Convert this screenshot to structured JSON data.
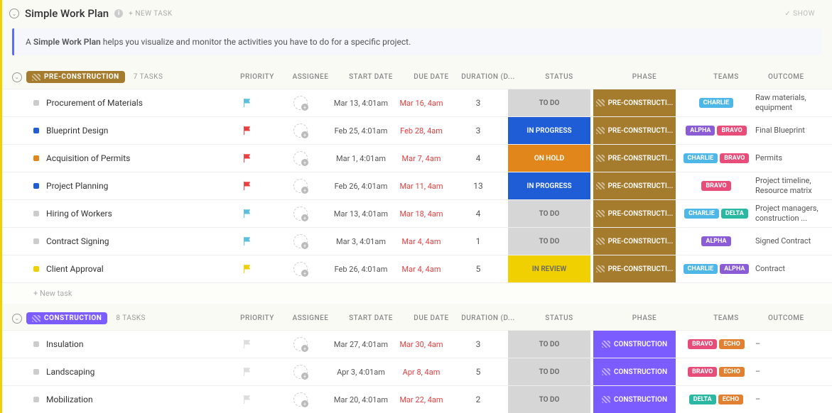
{
  "header": {
    "title": "Simple Work Plan",
    "new_task": "+ NEW TASK",
    "show": "✓ SHOW"
  },
  "description": {
    "prefix": "A ",
    "emph": "Simple Work Plan",
    "suffix": " helps you visualize and monitor the activities you have to do for a specific project."
  },
  "columns": {
    "priority": "PRIORITY",
    "assignee": "ASSIGNEE",
    "start": "START DATE",
    "due": "DUE DATE",
    "duration": "DURATION (D...",
    "status": "STATUS",
    "phase": "PHASE",
    "teams": "TEAMS",
    "outcome": "OUTCOME"
  },
  "new_task_row": "+ New task",
  "groups": [
    {
      "name": "PRE-CONSTRUCTION",
      "color": "brown",
      "count": "7 TASKS",
      "phase_label": "PRE-CONSTRUCTI...",
      "phase_color": "ph-brown",
      "rows": [
        {
          "name": "Procurement of Materials",
          "dot": "sd-gray",
          "flag": "#5bc0de",
          "start": "Mar 13, 4:01am",
          "due": "Mar 16, 4am",
          "dur": "3",
          "status": "TO DO",
          "st": "st-todo",
          "teams": [
            {
              "n": "CHARLIE",
              "c": "tp-charlie"
            }
          ],
          "outcome": "Raw materials, equipment"
        },
        {
          "name": "Blueprint Design",
          "dot": "sd-blue",
          "flag": "#e84040",
          "start": "Feb 25, 4:01am",
          "due": "Feb 28, 4am",
          "dur": "3",
          "status": "IN PROGRESS",
          "st": "st-progress",
          "teams": [
            {
              "n": "ALPHA",
              "c": "tp-alpha"
            },
            {
              "n": "BRAVO",
              "c": "tp-bravo"
            }
          ],
          "outcome": "Final Blueprint"
        },
        {
          "name": "Acquisition of Permits",
          "dot": "sd-orange",
          "flag": "#e84040",
          "start": "Mar 1, 4:01am",
          "due": "Mar 7, 4am",
          "dur": "4",
          "status": "ON HOLD",
          "st": "st-hold",
          "teams": [
            {
              "n": "CHARLIE",
              "c": "tp-charlie"
            },
            {
              "n": "BRAVO",
              "c": "tp-bravo"
            }
          ],
          "outcome": "Permits"
        },
        {
          "name": "Project Planning",
          "dot": "sd-blue",
          "flag": "#e84040",
          "start": "Feb 26, 4:01am",
          "due": "Mar 11, 4am",
          "dur": "13",
          "status": "IN PROGRESS",
          "st": "st-progress",
          "teams": [
            {
              "n": "BRAVO",
              "c": "tp-bravo"
            }
          ],
          "outcome": "Project timeline, Resource matrix"
        },
        {
          "name": "Hiring of Workers",
          "dot": "sd-gray",
          "flag": "#5bc0de",
          "start": "Mar 13, 4:01am",
          "due": "Mar 18, 4am",
          "dur": "4",
          "status": "TO DO",
          "st": "st-todo",
          "teams": [
            {
              "n": "CHARLIE",
              "c": "tp-charlie"
            },
            {
              "n": "DELTA",
              "c": "tp-delta"
            }
          ],
          "outcome": "Project managers, construction ..."
        },
        {
          "name": "Contract Signing",
          "dot": "sd-gray",
          "flag": "#5bc0de",
          "start": "Mar 3, 4:01am",
          "due": "Mar 4, 4am",
          "dur": "1",
          "status": "TO DO",
          "st": "st-todo",
          "teams": [
            {
              "n": "ALPHA",
              "c": "tp-alpha"
            }
          ],
          "outcome": "Signed Contract"
        },
        {
          "name": "Client Approval",
          "dot": "sd-yellow",
          "flag": "#f0d000",
          "start": "Feb 26, 4:01am",
          "due": "Mar 4, 4am",
          "dur": "5",
          "status": "IN REVIEW",
          "st": "st-review",
          "teams": [
            {
              "n": "CHARLIE",
              "c": "tp-charlie"
            },
            {
              "n": "ALPHA",
              "c": "tp-alpha"
            }
          ],
          "outcome": "Contract"
        }
      ],
      "show_new": true
    },
    {
      "name": "CONSTRUCTION",
      "color": "purple",
      "count": "8 TASKS",
      "phase_label": "CONSTRUCTION",
      "phase_color": "ph-purple",
      "rows": [
        {
          "name": "Insulation",
          "dot": "sd-gray",
          "flag": "#ddd",
          "start": "Mar 27, 4:01am",
          "due": "Mar 30, 4am",
          "dur": "3",
          "status": "TO DO",
          "st": "st-todo",
          "teams": [
            {
              "n": "BRAVO",
              "c": "tp-bravo"
            },
            {
              "n": "ECHO",
              "c": "tp-echo"
            }
          ],
          "outcome": "–"
        },
        {
          "name": "Landscaping",
          "dot": "sd-gray",
          "flag": "#ddd",
          "start": "Apr 3, 4:01am",
          "due": "Apr 8, 4am",
          "dur": "5",
          "status": "TO DO",
          "st": "st-todo",
          "teams": [
            {
              "n": "BRAVO",
              "c": "tp-bravo"
            },
            {
              "n": "ECHO",
              "c": "tp-echo"
            }
          ],
          "outcome": "–"
        },
        {
          "name": "Mobilization",
          "dot": "sd-gray",
          "flag": "#ddd",
          "start": "Mar 20, 4:01am",
          "due": "Mar 22, 4am",
          "dur": "2",
          "status": "TO DO",
          "st": "st-todo",
          "teams": [
            {
              "n": "DELTA",
              "c": "tp-delta"
            },
            {
              "n": "ECHO",
              "c": "tp-echo"
            }
          ],
          "outcome": "–"
        }
      ],
      "show_new": false
    }
  ]
}
